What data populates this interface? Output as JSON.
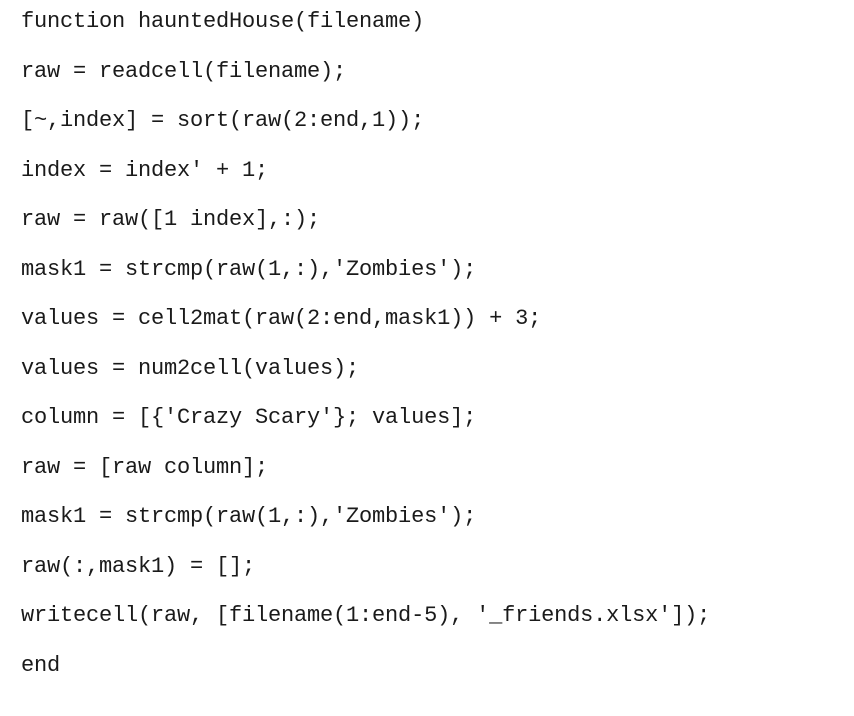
{
  "code": {
    "lines": [
      "function hauntedHouse(filename)",
      "raw = readcell(filename);",
      "[~,index] = sort(raw(2:end,1));",
      "index = index' + 1;",
      "raw = raw([1 index],:);",
      "mask1 = strcmp(raw(1,:),'Zombies');",
      "values = cell2mat(raw(2:end,mask1)) + 3;",
      "values = num2cell(values);",
      "column = [{'Crazy Scary'}; values];",
      "raw = [raw column];",
      "mask1 = strcmp(raw(1,:),'Zombies');",
      "raw(:,mask1) = [];",
      "writecell(raw, [filename(1:end-5), '_friends.xlsx']);",
      "end"
    ]
  }
}
